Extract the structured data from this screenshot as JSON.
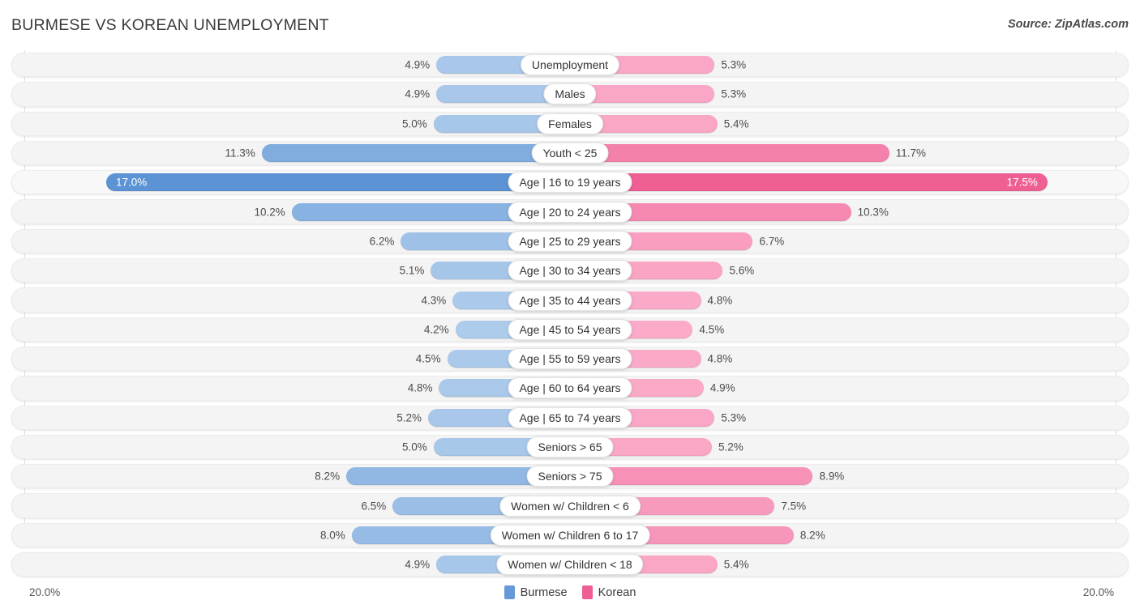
{
  "header": {
    "title": "BURMESE VS KOREAN UNEMPLOYMENT",
    "source": "Source: ZipAtlas.com"
  },
  "footer": {
    "axis_left": "20.0%",
    "axis_right": "20.0%",
    "legend": [
      {
        "label": "Burmese",
        "color": "#6699d8"
      },
      {
        "label": "Korean",
        "color": "#ef5f94"
      }
    ]
  },
  "chart_data": {
    "type": "bar",
    "title": "BURMESE VS KOREAN UNEMPLOYMENT",
    "subtitle": "Source: ZipAtlas.com",
    "orientation": "horizontal-diverging",
    "xlabel": "",
    "ylabel": "",
    "xlim": [
      20.0,
      20.0
    ],
    "axis_max": 20.0,
    "grid": true,
    "legend_position": "bottom-center",
    "categories": [
      "Unemployment",
      "Males",
      "Females",
      "Youth < 25",
      "Age | 16 to 19 years",
      "Age | 20 to 24 years",
      "Age | 25 to 29 years",
      "Age | 30 to 34 years",
      "Age | 35 to 44 years",
      "Age | 45 to 54 years",
      "Age | 55 to 59 years",
      "Age | 60 to 64 years",
      "Age | 65 to 74 years",
      "Seniors > 65",
      "Seniors > 75",
      "Women w/ Children < 6",
      "Women w/ Children 6 to 17",
      "Women w/ Children < 18"
    ],
    "series": [
      {
        "name": "Burmese",
        "side": "left",
        "color": "#6699d8",
        "values": [
          4.9,
          4.9,
          5.0,
          11.3,
          17.0,
          10.2,
          6.2,
          5.1,
          4.3,
          4.2,
          4.5,
          4.8,
          5.2,
          5.0,
          8.2,
          6.5,
          8.0,
          4.9
        ],
        "labels": [
          "4.9%",
          "4.9%",
          "5.0%",
          "11.3%",
          "17.0%",
          "10.2%",
          "6.2%",
          "5.1%",
          "4.3%",
          "4.2%",
          "4.5%",
          "4.8%",
          "5.2%",
          "5.0%",
          "8.2%",
          "6.5%",
          "8.0%",
          "4.9%"
        ]
      },
      {
        "name": "Korean",
        "side": "right",
        "color": "#ef5f94",
        "values": [
          5.3,
          5.3,
          5.4,
          11.7,
          17.5,
          10.3,
          6.7,
          5.6,
          4.8,
          4.5,
          4.8,
          4.9,
          5.3,
          5.2,
          8.9,
          7.5,
          8.2,
          5.4
        ],
        "labels": [
          "5.3%",
          "5.3%",
          "5.4%",
          "11.7%",
          "17.5%",
          "10.3%",
          "6.7%",
          "5.6%",
          "4.8%",
          "4.5%",
          "4.8%",
          "4.9%",
          "5.3%",
          "5.2%",
          "8.9%",
          "7.5%",
          "8.2%",
          "5.4%"
        ]
      }
    ],
    "highlighted_row": "Age | 16 to 19 years"
  }
}
